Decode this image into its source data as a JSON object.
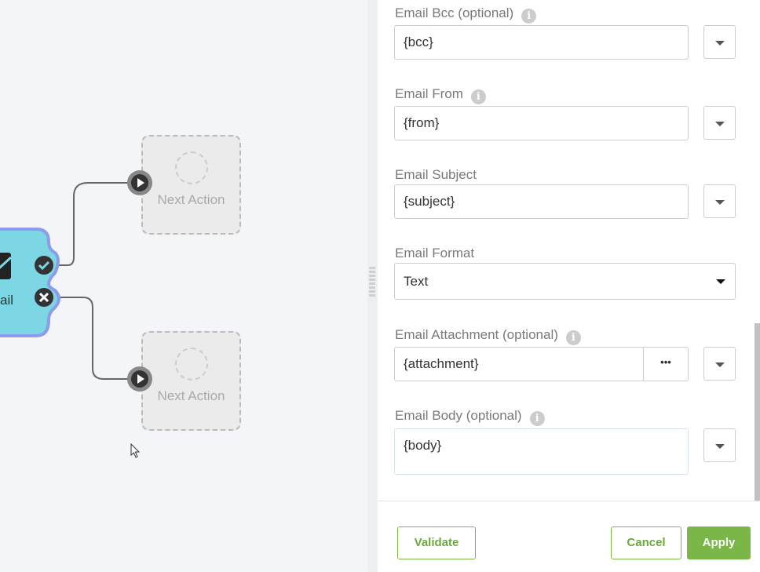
{
  "canvas": {
    "node_label": "ail",
    "next_actions": [
      {
        "label": "Next Action"
      },
      {
        "label": "Next Action"
      }
    ]
  },
  "fields": [
    {
      "label": "Email Bcc (optional)",
      "value": "{bcc}",
      "info": true
    },
    {
      "label": "Email From",
      "value": "{from}",
      "info": true
    },
    {
      "label": "Email Subject",
      "value": "{subject}"
    },
    {
      "label": "Email Format",
      "value": "Text"
    },
    {
      "label": "Email Attachment (optional)",
      "value": "{attachment}",
      "browse": "•••"
    },
    {
      "label": "Email Body (optional)",
      "value": "{body}"
    }
  ],
  "footer": {
    "validate": "Validate",
    "cancel": "Cancel",
    "apply": "Apply"
  },
  "colors": {
    "accent": "#7ab648",
    "node": "#7dd6e3",
    "node_border": "#8d9be8"
  }
}
